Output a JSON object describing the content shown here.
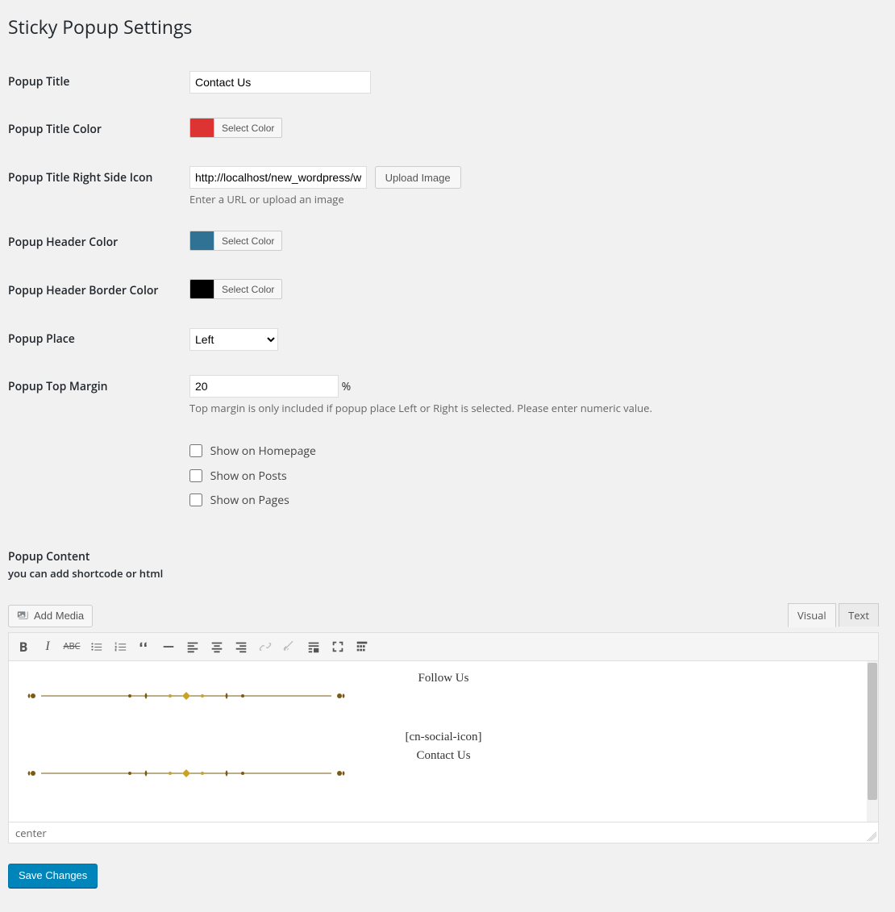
{
  "page": {
    "title": "Sticky Popup Settings"
  },
  "labels": {
    "popup_title": "Popup Title",
    "title_color": "Popup Title Color",
    "title_icon": "Popup Title Right Side Icon",
    "header_color": "Popup Header Color",
    "header_border_color": "Popup Header Border Color",
    "popup_place": "Popup Place",
    "top_margin": "Popup Top Margin",
    "content_head": "Popup Content",
    "content_sub": "you can add shortcode or html"
  },
  "fields": {
    "popup_title": "Contact Us",
    "title_color": "#dd3333",
    "title_icon_url": "http://localhost/new_wordpress/w",
    "icon_desc": "Enter a URL or upload an image",
    "header_color": "#2f7294",
    "header_border_color": "#000000",
    "popup_place": "Left",
    "top_margin": "20",
    "top_margin_unit": "%",
    "top_margin_desc": "Top margin is only included if popup place Left or Right is selected. Please enter numeric value.",
    "show_homepage": false,
    "show_posts": false,
    "show_pages": false
  },
  "buttons": {
    "select_color": "Select Color",
    "upload_image": "Upload Image",
    "add_media": "Add Media",
    "save": "Save Changes"
  },
  "checkbox_labels": {
    "homepage": "Show on Homepage",
    "posts": "Show on Posts",
    "pages": "Show on Pages"
  },
  "editor": {
    "tabs": {
      "visual": "Visual",
      "text": "Text",
      "active": "Visual"
    },
    "status_path": "center",
    "content": {
      "line1": "Follow Us",
      "line2": "[cn-social-icon]",
      "line3": "Contact Us"
    }
  }
}
